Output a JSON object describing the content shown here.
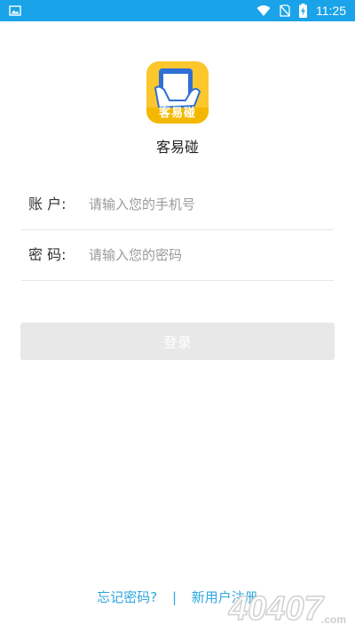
{
  "status_bar": {
    "time": "11:25",
    "left_icon": "image-icon",
    "icons": [
      "wifi-icon",
      "sim-off-icon",
      "battery-charging-icon"
    ],
    "bg_color": "#1aa3e8"
  },
  "app": {
    "logo_text": "客易碰",
    "name": "客易碰",
    "logo_color": "#fbc72d"
  },
  "form": {
    "account": {
      "label": "账  户:",
      "placeholder": "请输入您的手机号"
    },
    "password": {
      "label": "密  码:",
      "placeholder": "请输入您的密码"
    },
    "login_label": "登录"
  },
  "footer": {
    "forgot_label": "忘记密码?",
    "separator": "|",
    "register_label": "新用户注册",
    "link_color": "#2ea7df"
  },
  "watermark": {
    "text": "40407",
    "suffix": ".com"
  }
}
